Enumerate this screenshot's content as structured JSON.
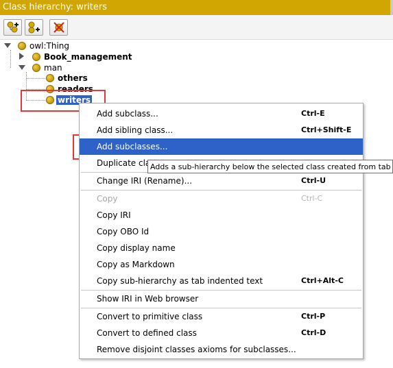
{
  "title": "Class hierarchy: writers",
  "toolbar": {
    "buttons": [
      {
        "name": "add-subclass-button",
        "icon": "add-subclass-icon"
      },
      {
        "name": "add-sibling-button",
        "icon": "add-sibling-icon"
      },
      {
        "name": "delete-class-button",
        "icon": "delete-class-icon"
      }
    ]
  },
  "tree": {
    "root": "owl:Thing",
    "book_management": "Book_management",
    "man": "man",
    "others": "others",
    "readers": "readers",
    "writers": "writers",
    "selected": "writers"
  },
  "context_menu": {
    "add_subclass": {
      "label": "Add subclass...",
      "shortcut": "Ctrl-E"
    },
    "add_sibling": {
      "label": "Add sibling class...",
      "shortcut": "Ctrl+Shift-E"
    },
    "add_subclasses": {
      "label": "Add subclasses..."
    },
    "duplicate": {
      "label": "Duplicate cla"
    },
    "change_iri": {
      "label": "Change IRI (Rename)...",
      "shortcut": "Ctrl-U"
    },
    "copy": {
      "label": "Copy",
      "shortcut": "Ctrl-C"
    },
    "copy_iri": {
      "label": "Copy IRI"
    },
    "copy_obo": {
      "label": "Copy OBO Id"
    },
    "copy_display": {
      "label": "Copy display name"
    },
    "copy_markdown": {
      "label": "Copy as Markdown"
    },
    "copy_subhierarchy": {
      "label": "Copy sub-hierarchy as tab indented text",
      "shortcut": "Ctrl+Alt-C"
    },
    "show_iri": {
      "label": "Show IRI in Web browser"
    },
    "convert_primitive": {
      "label": "Convert to primitive class",
      "shortcut": "Ctrl-P"
    },
    "convert_defined": {
      "label": "Convert to defined class",
      "shortcut": "Ctrl-D"
    },
    "remove_disjoint": {
      "label": "Remove disjoint classes axioms for subclasses..."
    }
  },
  "tooltip": "Adds a sub-hierarchy below the selected class created from tab indented text",
  "colors": {
    "title_bar": "#d2a602",
    "selection": "#2f62c9",
    "highlight_box": "#e23838",
    "class_bullet": "#d4a90c"
  }
}
